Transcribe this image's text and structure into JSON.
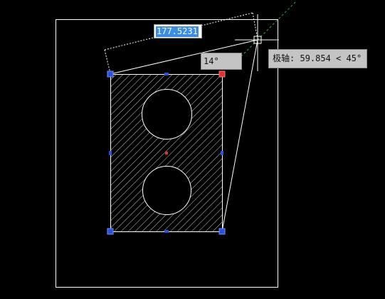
{
  "canvas": {
    "background": "#000000",
    "line_color": "#ffffff",
    "grip_color": "#2a50e0",
    "hot_grip_color": "#e03030",
    "tracking_line_color": "#2fa84a"
  },
  "dimension_input": {
    "value": "177.5231"
  },
  "angle_input": {
    "value": "14°"
  },
  "polar_tooltip": {
    "label": "极轴:",
    "value": "59.854 < 45°"
  },
  "cursor": {
    "icon": "crosshair-icon"
  },
  "hatch": {
    "pattern": "ANSI31"
  }
}
